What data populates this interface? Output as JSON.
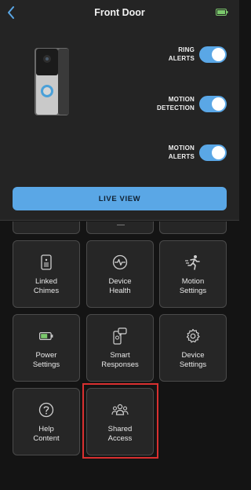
{
  "header": {
    "title": "Front Door",
    "back_icon": "chevron-left-icon",
    "battery_icon": "battery-icon",
    "accent": "#5aa7e6"
  },
  "toggles": [
    {
      "label_line1": "RING",
      "label_line2": "ALERTS",
      "on": true
    },
    {
      "label_line1": "MOTION",
      "label_line2": "DETECTION",
      "on": true
    },
    {
      "label_line1": "MOTION",
      "label_line2": "ALERTS",
      "on": true
    }
  ],
  "live_view_label": "LIVE VIEW",
  "tiles": [
    {
      "line1": "Linked",
      "line2": "Chimes",
      "icon": "chime-icon"
    },
    {
      "line1": "Device",
      "line2": "Health",
      "icon": "pulse-icon"
    },
    {
      "line1": "Motion",
      "line2": "Settings",
      "icon": "running-person-icon"
    },
    {
      "line1": "Power",
      "line2": "Settings",
      "icon": "battery-icon"
    },
    {
      "line1": "Smart",
      "line2": "Responses",
      "icon": "smart-response-icon"
    },
    {
      "line1": "Device",
      "line2": "Settings",
      "icon": "gear-icon"
    },
    {
      "line1": "Help",
      "line2": "Content",
      "icon": "question-icon"
    },
    {
      "line1": "Shared",
      "line2": "Access",
      "icon": "users-icon"
    }
  ],
  "highlight_color": "#d93030"
}
